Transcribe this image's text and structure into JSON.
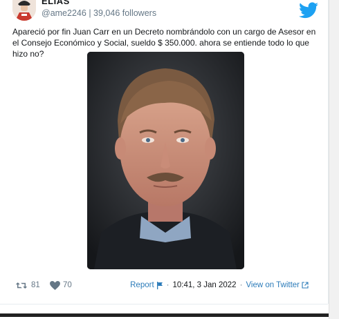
{
  "author": {
    "name": "ELIAS",
    "handle": "@ame2246",
    "separator": "|",
    "followers": "39,046 followers"
  },
  "tweet": {
    "text": "Apareció por fin Juan Carr en un Decreto nombrándolo con un cargo de Asesor en el Consejo Económico y Social, sueldo $ 350.000. ahora se entiende todo lo que hizo no?"
  },
  "stats": {
    "retweets": "81",
    "likes": "70"
  },
  "footer": {
    "report_label": "Report",
    "timestamp": "10:41, 3 Jan 2022",
    "view_label": "View on Twitter"
  },
  "colors": {
    "twitter_blue": "#1da1f2",
    "link_blue": "#2b7bb9",
    "muted_gray": "#657786"
  },
  "icons": {
    "brand": "twitter-bird-icon",
    "retweet": "retweet-icon",
    "like": "heart-icon",
    "report": "flag-icon",
    "external": "external-link-icon"
  }
}
